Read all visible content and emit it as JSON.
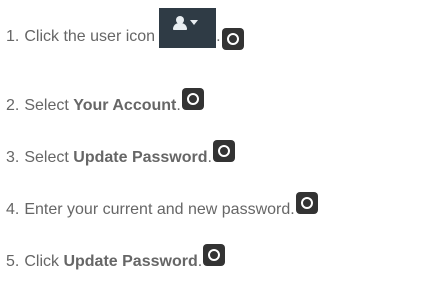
{
  "steps": [
    {
      "number": "1.",
      "text": "Click the user icon",
      "suffix": "."
    },
    {
      "number": "2.",
      "prefix": "Select ",
      "bold": "Your Account",
      "suffix": "."
    },
    {
      "number": "3.",
      "prefix": "Select ",
      "bold": "Update Password",
      "suffix": "."
    },
    {
      "number": "4.",
      "text": "Enter your current and new password."
    },
    {
      "number": "5.",
      "prefix": "Click ",
      "bold": "Update Password",
      "suffix": "."
    }
  ],
  "icons": {
    "user_menu": "user-menu-icon",
    "camera": "camera-icon"
  }
}
